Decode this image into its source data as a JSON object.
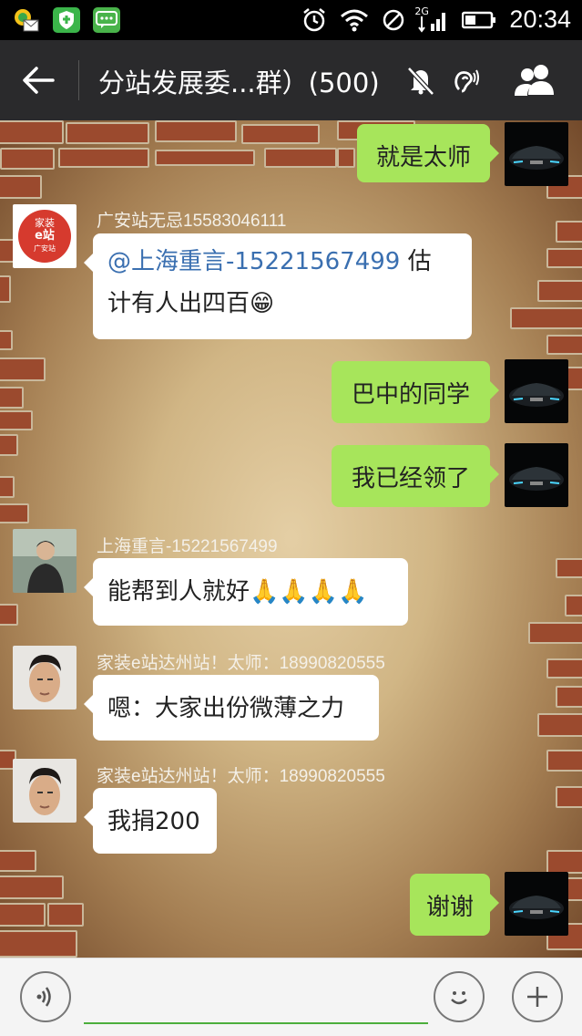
{
  "status_bar": {
    "network": "2G",
    "time": "20:34"
  },
  "header": {
    "title": "分站发展委...群）(500)"
  },
  "messages": [
    {
      "side": "right",
      "text": "就是太师"
    },
    {
      "side": "left",
      "sender": "广安站无忌15583046111",
      "mention": "@上海重言-15221567499",
      "text_line1_suffix": " 估",
      "text_line2": "计有人出四百😁"
    },
    {
      "side": "right",
      "text": "巴中的同学"
    },
    {
      "side": "right",
      "text": "我已经领了"
    },
    {
      "side": "left",
      "sender": "上海重言-15221567499",
      "text": "能帮到人就好🙏🙏🙏🙏"
    },
    {
      "side": "left",
      "sender": "家装e站达州站！太师：18990820555",
      "text": "嗯：大家出份微薄之力"
    },
    {
      "side": "left",
      "sender": "家装e站达州站！太师：18990820555",
      "text": "我捐200"
    },
    {
      "side": "right",
      "text": "谢谢"
    }
  ],
  "avatars": {
    "guangan_logo_line1": "家装",
    "guangan_logo_line2": "e站",
    "guangan_logo_line3": "广安站"
  },
  "colors": {
    "green_bubble": "#a7e55b",
    "title_bar": "#2a2a2c",
    "mention": "#3a6fb0"
  }
}
